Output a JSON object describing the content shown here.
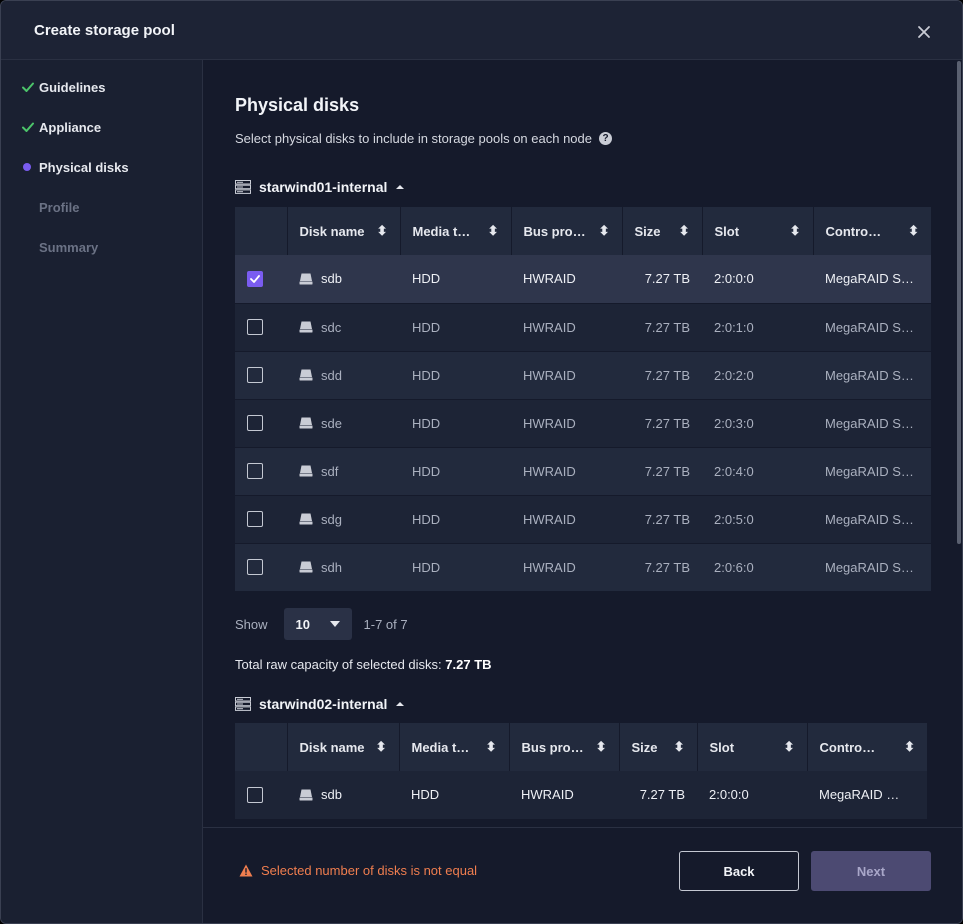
{
  "dialog": {
    "title": "Create storage pool",
    "close_icon": "close-icon"
  },
  "sidebar": {
    "steps": [
      {
        "label": "Guidelines",
        "state": "done",
        "icon": "check-icon"
      },
      {
        "label": "Appliance",
        "state": "done",
        "icon": "check-icon"
      },
      {
        "label": "Physical disks",
        "state": "current",
        "icon": "dot-icon"
      },
      {
        "label": "Profile",
        "state": "todo"
      },
      {
        "label": "Summary",
        "state": "todo"
      }
    ]
  },
  "main": {
    "heading": "Physical disks",
    "subtitle": "Select physical disks to include in storage pools on each node",
    "help_icon": "question-circle-icon"
  },
  "columns": [
    "Disk name",
    "Media t…",
    "Bus pro…",
    "Size",
    "Slot",
    "Contro…"
  ],
  "nodes": [
    {
      "name": "starwind01-internal",
      "disks": [
        {
          "name": "sdb",
          "media": "HDD",
          "bus": "HWRAID",
          "size": "7.27 TB",
          "slot": "2:0:0:0",
          "controller": "MegaRAID S…",
          "checked": true
        },
        {
          "name": "sdc",
          "media": "HDD",
          "bus": "HWRAID",
          "size": "7.27 TB",
          "slot": "2:0:1:0",
          "controller": "MegaRAID S…",
          "checked": false
        },
        {
          "name": "sdd",
          "media": "HDD",
          "bus": "HWRAID",
          "size": "7.27 TB",
          "slot": "2:0:2:0",
          "controller": "MegaRAID S…",
          "checked": false
        },
        {
          "name": "sde",
          "media": "HDD",
          "bus": "HWRAID",
          "size": "7.27 TB",
          "slot": "2:0:3:0",
          "controller": "MegaRAID S…",
          "checked": false
        },
        {
          "name": "sdf",
          "media": "HDD",
          "bus": "HWRAID",
          "size": "7.27 TB",
          "slot": "2:0:4:0",
          "controller": "MegaRAID S…",
          "checked": false
        },
        {
          "name": "sdg",
          "media": "HDD",
          "bus": "HWRAID",
          "size": "7.27 TB",
          "slot": "2:0:5:0",
          "controller": "MegaRAID S…",
          "checked": false
        },
        {
          "name": "sdh",
          "media": "HDD",
          "bus": "HWRAID",
          "size": "7.27 TB",
          "slot": "2:0:6:0",
          "controller": "MegaRAID S…",
          "checked": false
        }
      ],
      "pager": {
        "show_label": "Show",
        "page_size": "10",
        "range": "1-7 of 7"
      },
      "capacity_label": "Total raw capacity of selected disks:",
      "capacity_value": "7.27 TB"
    },
    {
      "name": "starwind02-internal",
      "disks": [
        {
          "name": "sdb",
          "media": "HDD",
          "bus": "HWRAID",
          "size": "7.27 TB",
          "slot": "2:0:0:0",
          "controller": "MegaRAID …",
          "checked": false
        }
      ]
    }
  ],
  "footer": {
    "warning": "Selected number of disks is not equal",
    "back_label": "Back",
    "next_label": "Next"
  },
  "colors": {
    "accent": "#7a5cf0",
    "success": "#4cc46a",
    "warning": "#f07e4f"
  }
}
